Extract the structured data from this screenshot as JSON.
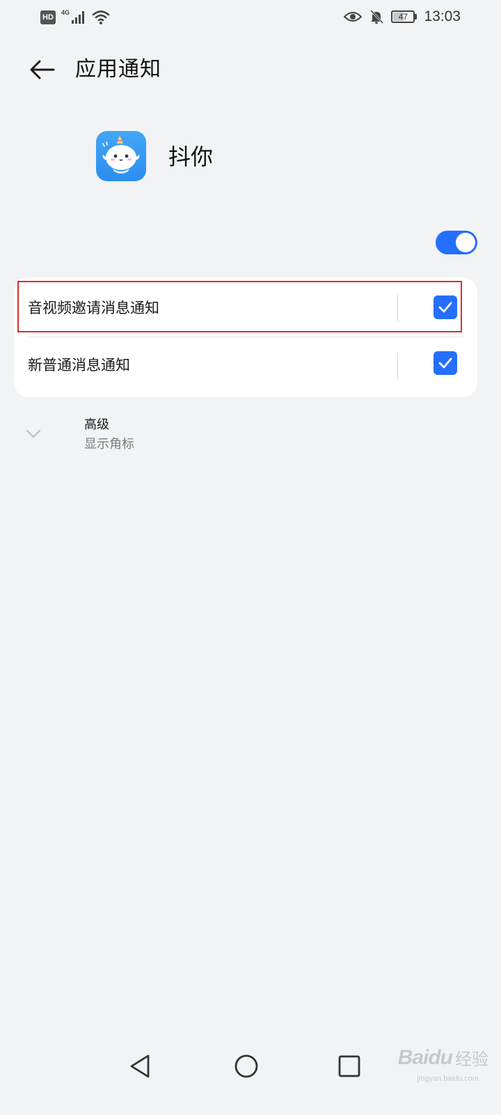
{
  "status_bar": {
    "hd_badge": "HD",
    "network_type": "4G",
    "battery_level": "47",
    "time": "13:03"
  },
  "header": {
    "title": "应用通知",
    "back_icon": "arrow-left-icon"
  },
  "app": {
    "name": "抖你",
    "notifications_enabled": true,
    "accent_color": "#256fff"
  },
  "notification_categories": [
    {
      "label": "音视频邀请消息通知",
      "checked": true
    },
    {
      "label": "新普通消息通知",
      "checked": true
    }
  ],
  "advanced": {
    "title": "高级",
    "subtitle": "显示角标",
    "icon": "chevron-down-icon"
  },
  "navbar": {
    "back_icon": "triangle-back-icon",
    "home_icon": "circle-home-icon",
    "recent_icon": "square-recent-icon"
  },
  "watermark": {
    "brand": "Baidu",
    "brand_cn": "经验",
    "url": "jingyan.baidu.com"
  }
}
